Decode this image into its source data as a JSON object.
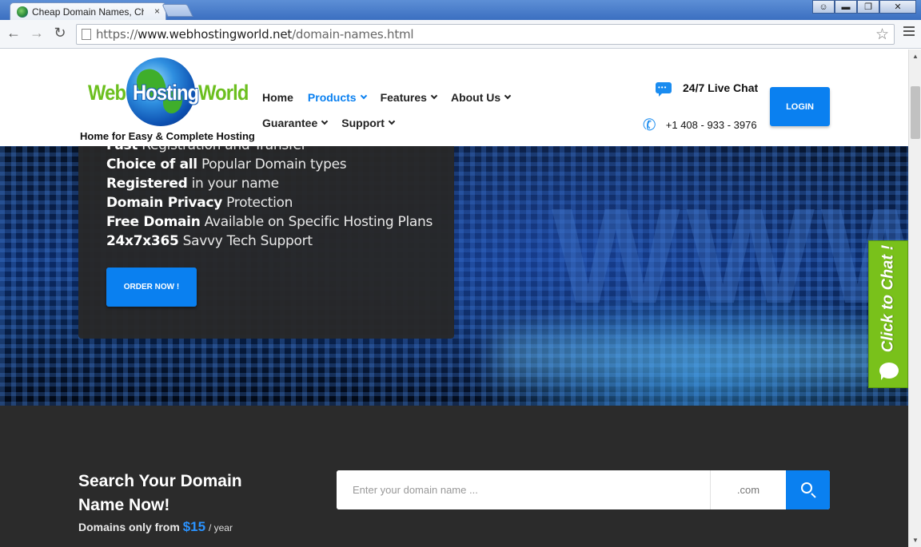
{
  "browser": {
    "tab_title": "Cheap Domain Names, Cheap",
    "tab_close": "×",
    "url_scheme": "https://",
    "url_host": "www.webhostingworld.net",
    "url_path": "/domain-names.html"
  },
  "header": {
    "logo": {
      "word1": "Web",
      "word2": "Hosting",
      "word3": "World",
      "tagline": "Home for Easy & Complete Hosting"
    },
    "nav": {
      "row1": [
        {
          "label": "Home",
          "active": false,
          "dropdown": false
        },
        {
          "label": "Products",
          "active": true,
          "dropdown": true
        },
        {
          "label": "Features",
          "active": false,
          "dropdown": true
        },
        {
          "label": "About Us",
          "active": false,
          "dropdown": true
        }
      ],
      "row2": [
        {
          "label": "Guarantee",
          "active": false,
          "dropdown": true
        },
        {
          "label": "Support",
          "active": false,
          "dropdown": true
        }
      ]
    },
    "live_chat": "24/7 Live Chat",
    "phone": "+1 408 - 933 - 3976",
    "login_label": "LOGIN"
  },
  "hero": {
    "features": [
      {
        "bold": "Fast",
        "rest": " Registration and Transfer"
      },
      {
        "bold": "Choice of all",
        "rest": " Popular Domain types"
      },
      {
        "bold": "Registered",
        "rest": " in your name"
      },
      {
        "bold": "Domain Privacy",
        "rest": " Protection"
      },
      {
        "bold": "Free Domain",
        "rest": " Available on Specific Hosting Plans"
      },
      {
        "bold": "24x7x365",
        "rest": " Savvy Tech Support"
      }
    ],
    "order_label": "ORDER NOW !",
    "background_text": "WWW",
    "slides_total": 6,
    "slide_active": 1
  },
  "domain_search": {
    "title": "Search Your Domain Name Now!",
    "price_prefix": "Domains only from",
    "price_amount": "$15",
    "price_suffix": "/ year",
    "input_placeholder": "Enter your domain name ...",
    "input_value": "",
    "tld_selected": ".com"
  },
  "chat_tab": {
    "label": "Click to Chat !"
  },
  "colors": {
    "accent": "#0a80f0",
    "chat_green": "#79c11b",
    "dark_section": "#2b2b2b"
  }
}
